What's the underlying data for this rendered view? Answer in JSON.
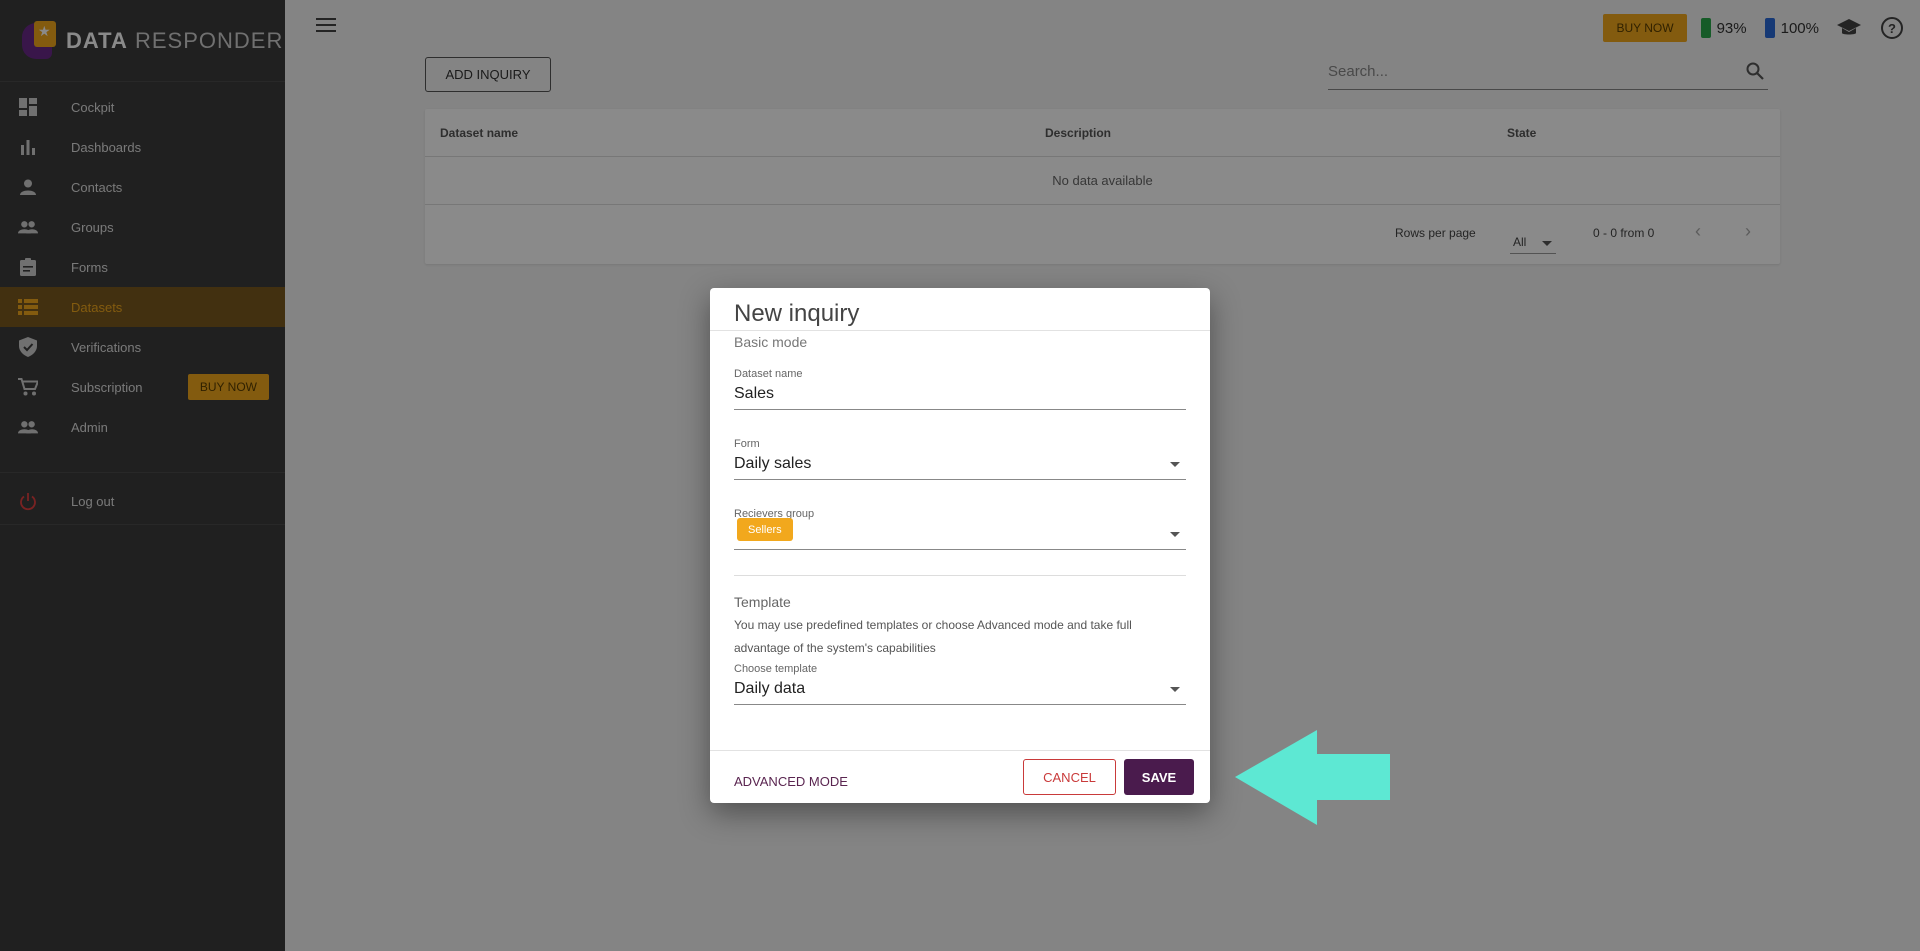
{
  "app": {
    "logo_bold": "DATA",
    "logo_regular": "RESPONDER"
  },
  "sidebar": {
    "items": [
      {
        "label": "Cockpit",
        "icon": "dashboard-icon",
        "active": false
      },
      {
        "label": "Dashboards",
        "icon": "bar-chart-icon",
        "active": false
      },
      {
        "label": "Contacts",
        "icon": "person-icon",
        "active": false
      },
      {
        "label": "Groups",
        "icon": "people-icon",
        "active": false
      },
      {
        "label": "Forms",
        "icon": "clipboard-icon",
        "active": false
      },
      {
        "label": "Datasets",
        "icon": "list-icon",
        "active": true
      },
      {
        "label": "Verifications",
        "icon": "shield-icon",
        "active": false
      },
      {
        "label": "Subscription",
        "icon": "cart-icon",
        "active": false
      },
      {
        "label": "Admin",
        "icon": "admin-icon",
        "active": false
      }
    ],
    "buy_now": "BUY NOW",
    "logout": "Log out"
  },
  "topbar": {
    "buy_now": "BUY NOW",
    "battery_green": "93%",
    "battery_blue": "100%"
  },
  "main": {
    "add_button": "ADD INQUIRY",
    "search_placeholder": "Search...",
    "table": {
      "columns": [
        "Dataset name",
        "Description",
        "State"
      ],
      "empty_text": "No data available",
      "rows_per_page_label": "Rows per page",
      "rows_per_page_value": "All",
      "range_text": "0 - 0 from 0"
    }
  },
  "dialog": {
    "title": "New inquiry",
    "mode": "Basic mode",
    "dataset_name_label": "Dataset name",
    "dataset_name_value": "Sales",
    "form_label": "Form",
    "form_value": "Daily sales",
    "receivers_label": "Recievers group",
    "receivers_chip": "Sellers",
    "template_title": "Template",
    "template_description": "You may use predefined templates or choose Advanced mode and take full advantage of the system's capabilities",
    "choose_template_label": "Choose template",
    "choose_template_value": "Daily data",
    "advanced_button": "ADVANCED MODE",
    "cancel_button": "CANCEL",
    "save_button": "SAVE"
  },
  "colors": {
    "accent": "#f2a81d",
    "primary": "#4a1b4d",
    "danger": "#c93a3a",
    "annotation_arrow": "#5de8d3"
  }
}
